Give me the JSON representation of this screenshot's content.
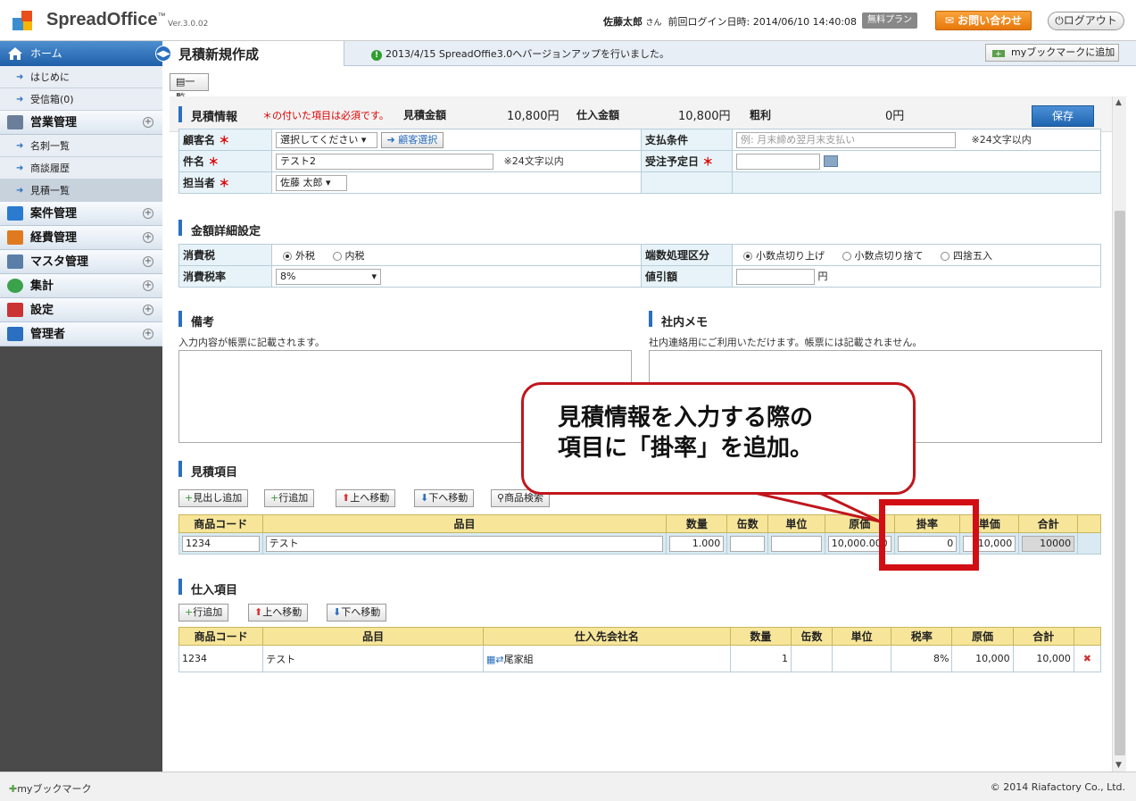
{
  "header": {
    "logo_text": "SpreadOffice",
    "logo_tm": "™",
    "version": "Ver.3.0.02",
    "user_name": "佐藤太郎",
    "user_suffix": "さん",
    "last_login": "前回ログイン日時: 2014/06/10 14:40:08",
    "plan_badge": "無料プラン",
    "contact_label": "お問い合わせ",
    "logout_label": "ログアウト"
  },
  "sidebar": {
    "home_label": "ホーム",
    "home_items": [
      {
        "label": "はじめに"
      },
      {
        "label": "受信箱(0)"
      }
    ],
    "sales_label": "営業管理",
    "sales_items": [
      {
        "label": "名刺一覧"
      },
      {
        "label": "商談履歴"
      },
      {
        "label": "見積一覧"
      }
    ],
    "sections": [
      {
        "label": "案件管理",
        "color": "#2a7bd0"
      },
      {
        "label": "経費管理",
        "color": "#e07a1f"
      },
      {
        "label": "マスタ管理",
        "color": "#5a7ea8"
      },
      {
        "label": "集計",
        "color": "#3aa24a"
      },
      {
        "label": "設定",
        "color": "#c33"
      },
      {
        "label": "管理者",
        "color": "#2a6fc0"
      }
    ]
  },
  "main": {
    "page_title": "見積新規作成",
    "notice": "2013/4/15 SpreadOffie3.0へバージョンアップを行いました。",
    "bookmark_add": "myブックマークに追加",
    "list_button": "一覧",
    "summary": {
      "title": "見積情報",
      "required_note": "＊の付いた項目は必須です。",
      "est_amount_label": "見積金額",
      "est_amount_value": "10,800円",
      "purchase_amount_label": "仕入金額",
      "purchase_amount_value": "10,800円",
      "profit_label": "粗利",
      "profit_value": "0円",
      "save_label": "保存"
    },
    "form": {
      "customer_label": "顧客名",
      "customer_select": "選択してください",
      "customer_button": "顧客選択",
      "payment_label": "支払条件",
      "payment_placeholder": "例: 月末締め翌月末支払い",
      "payment_note": "※24文字以内",
      "subject_label": "件名",
      "subject_value": "テスト2",
      "subject_note": "※24文字以内",
      "order_date_label": "受注予定日",
      "staff_label": "担当者",
      "staff_value": "佐藤 太郎"
    },
    "amount_section": {
      "title": "金額詳細設定",
      "tax_label": "消費税",
      "tax_opt1": "外税",
      "tax_opt2": "内税",
      "rounding_label": "端数処理区分",
      "round_opt1": "小数点切り上げ",
      "round_opt2": "小数点切り捨て",
      "round_opt3": "四捨五入",
      "tax_rate_label": "消費税率",
      "tax_rate_value": "8%",
      "discount_label": "値引額",
      "discount_unit": "円"
    },
    "remarks": {
      "title": "備考",
      "note": "入力内容が帳票に記載されます。"
    },
    "memo": {
      "title": "社内メモ",
      "note": "社内連絡用にご利用いただけます。帳票には記載されません。"
    },
    "estimate_items": {
      "title": "見積項目",
      "buttons": [
        "見出し追加",
        "行追加",
        "上へ移動",
        "下へ移動",
        "商品検索"
      ],
      "columns": [
        "商品コード",
        "品目",
        "数量",
        "缶数",
        "単位",
        "原価",
        "掛率",
        "単価",
        "合計"
      ],
      "rows": [
        {
          "code": "1234",
          "item": "テスト",
          "qty": "1.000",
          "cans": "",
          "unit": "",
          "cost": "10,000.000",
          "rate": "0",
          "price": "10,000",
          "total": "10000"
        }
      ]
    },
    "purchase_items": {
      "title": "仕入項目",
      "buttons": [
        "行追加",
        "上へ移動",
        "下へ移動"
      ],
      "columns": [
        "商品コード",
        "品目",
        "仕入先会社名",
        "数量",
        "缶数",
        "単位",
        "税率",
        "原価",
        "合計"
      ],
      "rows": [
        {
          "code": "1234",
          "item": "テスト",
          "supplier": "尾家組",
          "qty": "1",
          "cans": "",
          "unit": "",
          "tax": "8%",
          "cost": "10,000",
          "total": "10,000"
        }
      ]
    }
  },
  "callout": {
    "line1": "見積情報を入力する際の",
    "line2": "項目に「掛率」を追加。"
  },
  "footer": {
    "bookmark": "myブックマーク",
    "copyright": "© 2014 Riafactory Co., Ltd."
  }
}
